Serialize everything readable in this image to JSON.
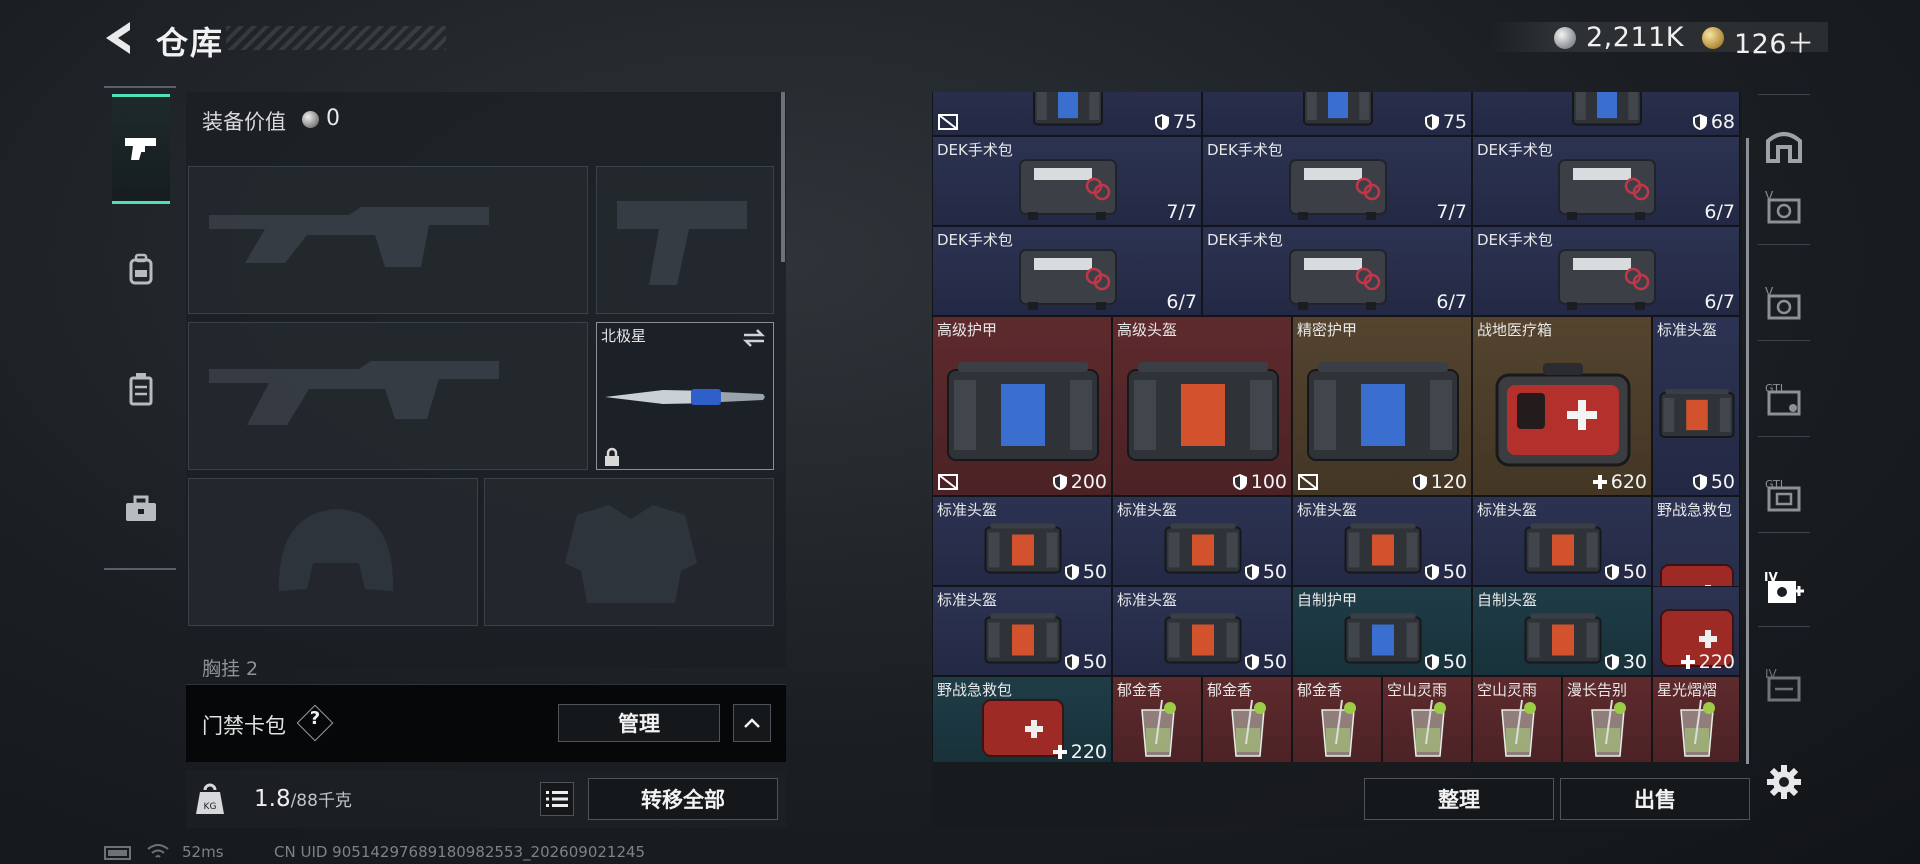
{
  "header": {
    "title": "仓库",
    "currency": [
      {
        "icon": "silver-coin-icon",
        "amount": "2,211K"
      },
      {
        "icon": "gold-coin-icon",
        "amount": "126＋"
      }
    ]
  },
  "sidebar": {
    "tabs": [
      {
        "icon": "pistol-icon",
        "active": true
      },
      {
        "icon": "backpack-icon",
        "active": false
      },
      {
        "icon": "chest-rig-icon",
        "active": false
      },
      {
        "icon": "toolbox-icon",
        "active": false
      }
    ]
  },
  "loadout": {
    "equip_value_label": "装备价值",
    "equip_value": "0",
    "knife_name": "北极星",
    "chest_label": "胸挂 2"
  },
  "keycard": {
    "label": "门禁卡包",
    "help": "?",
    "manage_label": "管理"
  },
  "weight": {
    "current": "1.8",
    "capacity": "/88千克",
    "transfer_label": "转移全部"
  },
  "status": {
    "ping": "52ms",
    "uid": "CN UID 9051429768918098255​3_202609021245"
  },
  "inventory": {
    "sort_label": "整理",
    "sell_label": "出售",
    "items": [
      {
        "name": "",
        "value": "75",
        "kind": "armor",
        "tint": "blue",
        "vest": true
      },
      {
        "name": "",
        "value": "75",
        "kind": "armor",
        "tint": "blue",
        "vest": false
      },
      {
        "name": "",
        "value": "68",
        "kind": "armor",
        "tint": "blue",
        "vest": false
      },
      {
        "name": "DEK手术包",
        "value": "7/7",
        "kind": "kit",
        "tint": "blue"
      },
      {
        "name": "DEK手术包",
        "value": "7/7",
        "kind": "kit",
        "tint": "blue"
      },
      {
        "name": "DEK手术包",
        "value": "6/7",
        "kind": "kit",
        "tint": "blue"
      },
      {
        "name": "DEK手术包",
        "value": "6/7",
        "kind": "kit",
        "tint": "blue"
      },
      {
        "name": "DEK手术包",
        "value": "6/7",
        "kind": "kit",
        "tint": "blue"
      },
      {
        "name": "DEK手术包",
        "value": "6/7",
        "kind": "kit",
        "tint": "blue"
      },
      {
        "name": "高级护甲",
        "value": "200",
        "kind": "armor",
        "tint": "red",
        "vest": true
      },
      {
        "name": "高级头盔",
        "value": "100",
        "kind": "helmet",
        "tint": "red",
        "vest": false
      },
      {
        "name": "精密护甲",
        "value": "120",
        "kind": "armor",
        "tint": "gold",
        "vest": true
      },
      {
        "name": "战地医疗箱",
        "value": "620",
        "kind": "medbox",
        "tint": "gold"
      },
      {
        "name": "标准头盔",
        "value": "50",
        "kind": "helmet",
        "tint": "blue"
      },
      {
        "name": "标准头盔",
        "value": "50",
        "kind": "helmet",
        "tint": "blue"
      },
      {
        "name": "标准头盔",
        "value": "50",
        "kind": "helmet",
        "tint": "blue"
      },
      {
        "name": "标准头盔",
        "value": "50",
        "kind": "helmet",
        "tint": "blue"
      },
      {
        "name": "标准头盔",
        "value": "50",
        "kind": "helmet",
        "tint": "blue"
      },
      {
        "name": "野战急救包",
        "value": "",
        "kind": "firstaid",
        "tint": "blue"
      },
      {
        "name": "标准头盔",
        "value": "50",
        "kind": "helmet",
        "tint": "blue"
      },
      {
        "name": "标准头盔",
        "value": "50",
        "kind": "helmet",
        "tint": "blue"
      },
      {
        "name": "自制护甲",
        "value": "50",
        "kind": "armor",
        "tint": "teal"
      },
      {
        "name": "自制头盔",
        "value": "30",
        "kind": "helmet",
        "tint": "teal"
      },
      {
        "name": "",
        "value": "220",
        "kind": "firstaid",
        "tint": "blue"
      },
      {
        "name": "野战急救包",
        "value": "220",
        "kind": "firstaid",
        "tint": "teal"
      },
      {
        "name": "郁金香",
        "value": "",
        "kind": "drink",
        "tint": "red"
      },
      {
        "name": "郁金香",
        "value": "",
        "kind": "drink",
        "tint": "red"
      },
      {
        "name": "郁金香",
        "value": "",
        "kind": "drink",
        "tint": "red"
      },
      {
        "name": "空山灵雨",
        "value": "",
        "kind": "drink",
        "tint": "red"
      },
      {
        "name": "空山灵雨",
        "value": "",
        "kind": "drink",
        "tint": "red"
      },
      {
        "name": "漫长告别",
        "value": "",
        "kind": "drink",
        "tint": "red"
      },
      {
        "name": "星光熠熠",
        "value": "",
        "kind": "drink",
        "tint": "red"
      }
    ]
  },
  "filters": [
    {
      "icon": "shelter-icon"
    },
    {
      "icon": "vault-v-icon"
    },
    {
      "icon": "vault-v2-icon"
    },
    {
      "icon": "vault-gt-icon"
    },
    {
      "icon": "vault-gt2-icon"
    },
    {
      "icon": "vault-iv-add-icon"
    },
    {
      "icon": "vault-iv-icon"
    },
    {
      "icon": "settings-gear-icon"
    }
  ],
  "colors": {
    "accent": "#4fe0b8",
    "tier_blue": "#2c3352",
    "tier_red": "#5e2a2d",
    "tier_gold": "#54442f",
    "tier_teal": "#1f3c47"
  }
}
